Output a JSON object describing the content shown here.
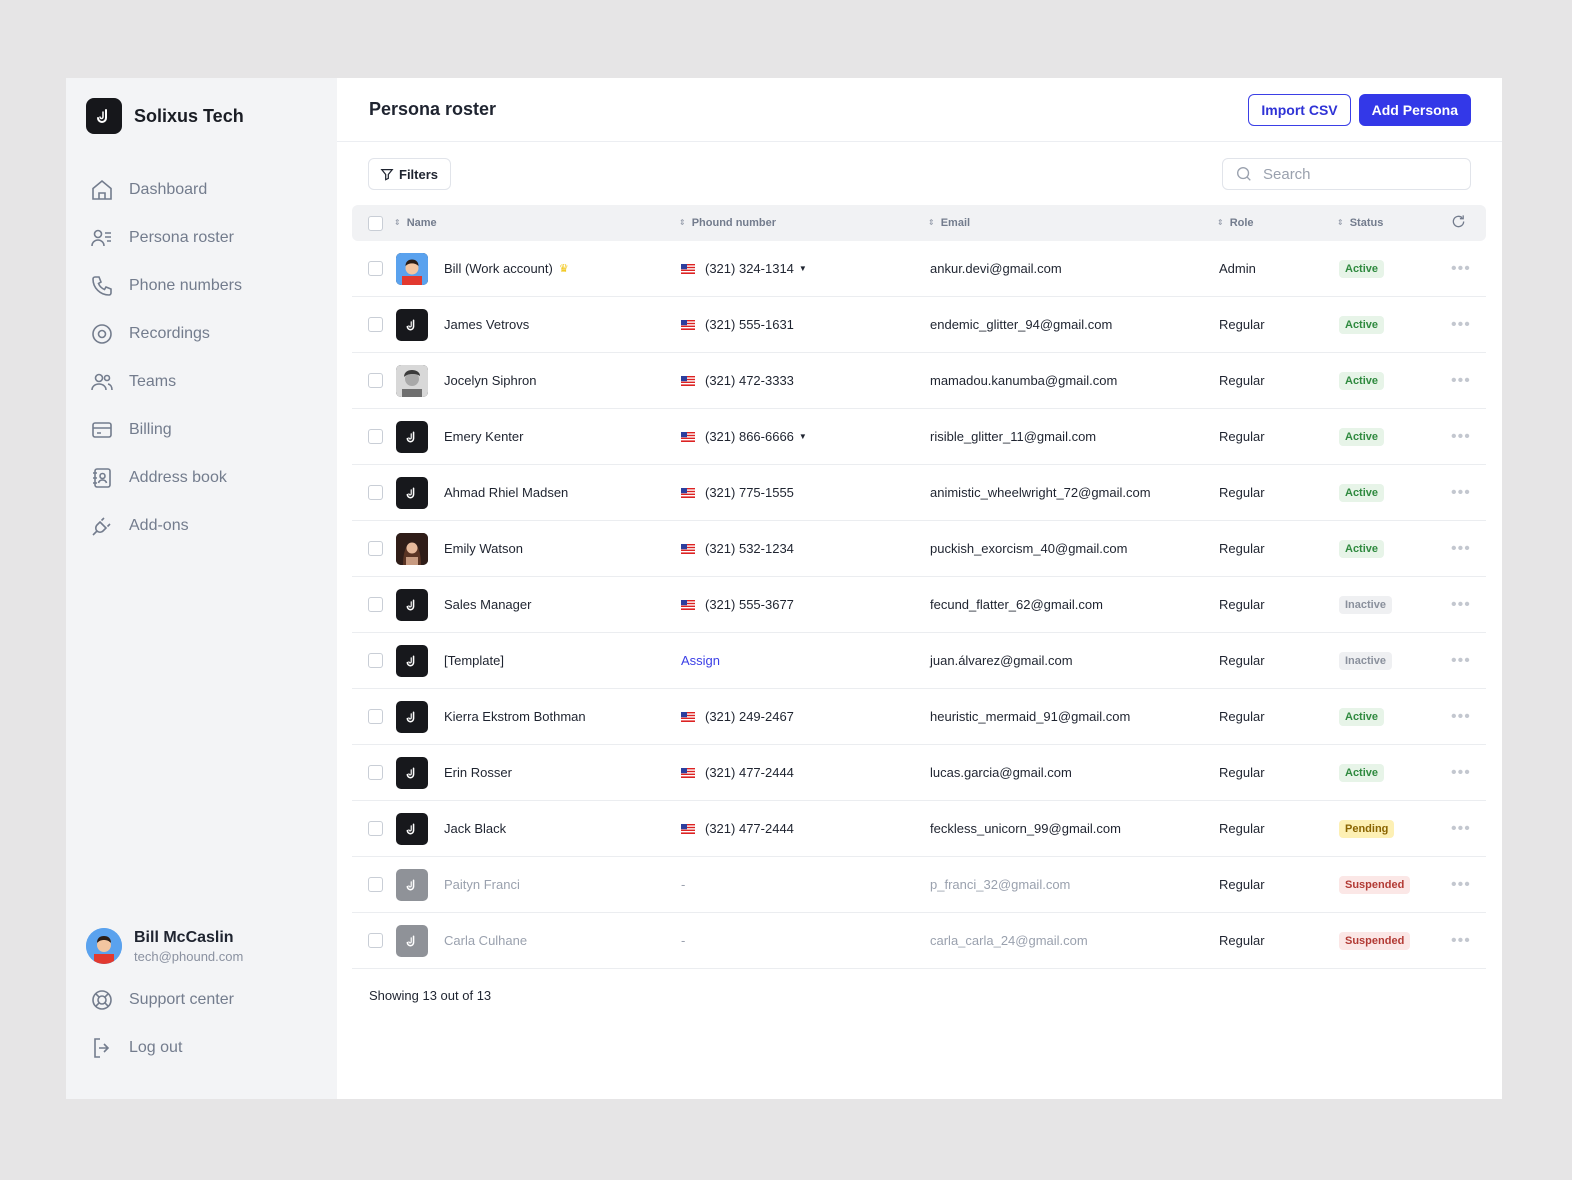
{
  "brand": {
    "name": "Solixus Tech"
  },
  "nav": [
    {
      "label": "Dashboard",
      "icon": "home-icon"
    },
    {
      "label": "Persona roster",
      "icon": "persona-icon"
    },
    {
      "label": "Phone numbers",
      "icon": "phone-icon"
    },
    {
      "label": "Recordings",
      "icon": "record-icon"
    },
    {
      "label": "Teams",
      "icon": "team-icon"
    },
    {
      "label": "Billing",
      "icon": "card-icon"
    },
    {
      "label": "Address book",
      "icon": "address-book-icon"
    },
    {
      "label": "Add-ons",
      "icon": "plug-icon"
    }
  ],
  "user": {
    "name": "Bill McCaslin",
    "email": "tech@phound.com"
  },
  "bottom_nav": [
    {
      "label": "Support center",
      "icon": "lifebuoy-icon"
    },
    {
      "label": "Log out",
      "icon": "logout-icon"
    }
  ],
  "header": {
    "title": "Persona roster",
    "import_label": "Import CSV",
    "add_label": "Add Persona"
  },
  "toolbar": {
    "filters_label": "Filters",
    "search_placeholder": "Search"
  },
  "table": {
    "columns": {
      "name": "Name",
      "phone": "Phound number",
      "email": "Email",
      "role": "Role",
      "status": "Status"
    },
    "rows": [
      {
        "name": "Bill (Work account)",
        "phone": "(321) 324-1314",
        "email": "ankur.devi@gmail.com",
        "role": "Admin",
        "status": "Active"
      },
      {
        "name": "James Vetrovs",
        "phone": "(321) 555-1631",
        "email": "endemic_glitter_94@gmail.com",
        "role": "Regular",
        "status": "Active"
      },
      {
        "name": "Jocelyn Siphron",
        "phone": "(321) 472-3333",
        "email": "mamadou.kanumba@gmail.com",
        "role": "Regular",
        "status": "Active"
      },
      {
        "name": "Emery Kenter",
        "phone": "(321) 866-6666",
        "email": "risible_glitter_11@gmail.com",
        "role": "Regular",
        "status": "Active"
      },
      {
        "name": "Ahmad Rhiel Madsen",
        "phone": "(321) 775-1555",
        "email": "animistic_wheelwright_72@gmail.com",
        "role": "Regular",
        "status": "Active"
      },
      {
        "name": "Emily Watson",
        "phone": "(321) 532-1234",
        "email": "puckish_exorcism_40@gmail.com",
        "role": "Regular",
        "status": "Active"
      },
      {
        "name": "Sales Manager",
        "phone": "(321) 555-3677",
        "email": "fecund_flatter_62@gmail.com",
        "role": "Regular",
        "status": "Inactive"
      },
      {
        "name": "[Template]",
        "phone": "Assign",
        "email": "juan.álvarez@gmail.com",
        "role": "Regular",
        "status": "Inactive"
      },
      {
        "name": "Kierra Ekstrom Bothman",
        "phone": "(321) 249-2467",
        "email": "heuristic_mermaid_91@gmail.com",
        "role": "Regular",
        "status": "Active"
      },
      {
        "name": "Erin Rosser",
        "phone": "(321) 477-2444",
        "email": "lucas.garcia@gmail.com",
        "role": "Regular",
        "status": "Active"
      },
      {
        "name": "Jack Black",
        "phone": "(321) 477-2444",
        "email": "feckless_unicorn_99@gmail.com",
        "role": "Regular",
        "status": "Pending"
      },
      {
        "name": "Paityn Franci",
        "phone": "-",
        "email": "p_franci_32@gmail.com",
        "role": "Regular",
        "status": "Suspended"
      },
      {
        "name": "Carla Culhane",
        "phone": "-",
        "email": "carla_carla_24@gmail.com",
        "role": "Regular",
        "status": "Suspended"
      }
    ]
  },
  "footer": {
    "count_text": "Showing 13 out of 13"
  },
  "colors": {
    "accent": "#3338e8",
    "active": "#2f8a3f",
    "pending": "#fdf0b4",
    "suspended": "#b23a34"
  }
}
